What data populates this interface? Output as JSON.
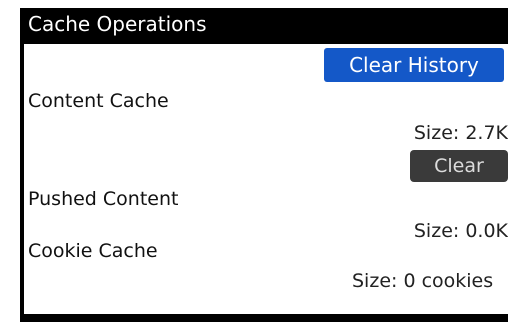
{
  "screen": {
    "title": "Cache Operations"
  },
  "actions": {
    "clear_history_label": "Clear History",
    "clear_label": "Clear"
  },
  "sections": {
    "content_cache": {
      "label": "Content Cache",
      "size": "Size: 2.7K"
    },
    "pushed_content": {
      "label": "Pushed Content",
      "size": "Size: 0.0K"
    },
    "cookie_cache": {
      "label": "Cookie Cache",
      "size": "Size: 0 cookies"
    }
  },
  "colors": {
    "title_bar_bg": "#000000",
    "primary_button": "#1458c8",
    "dark_button": "#3a3a3a"
  }
}
